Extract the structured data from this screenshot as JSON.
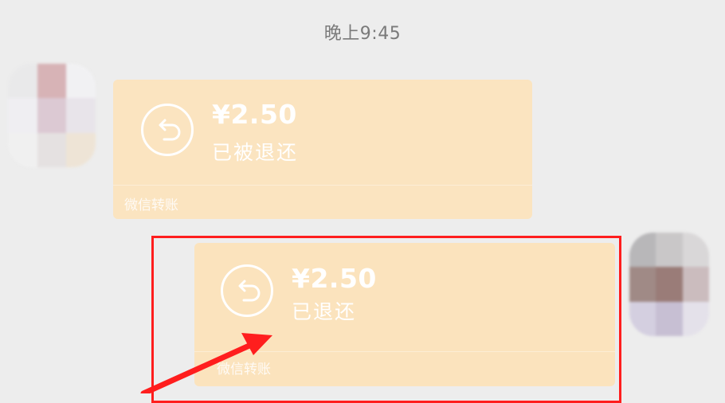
{
  "chat": {
    "timestamp": "晚上9:45",
    "messages": [
      {
        "side": "incoming",
        "amount": "¥2.50",
        "status": "已被退还",
        "service": "微信转账",
        "icon": "return-arrow-icon"
      },
      {
        "side": "outgoing",
        "amount": "¥2.50",
        "status": "已退还",
        "service": "微信转账",
        "icon": "return-arrow-icon"
      }
    ]
  },
  "colors": {
    "background": "#ededed",
    "bubble": "#fbe4c0",
    "highlight": "#ff1e1e",
    "text_on_bubble": "#ffffff"
  }
}
